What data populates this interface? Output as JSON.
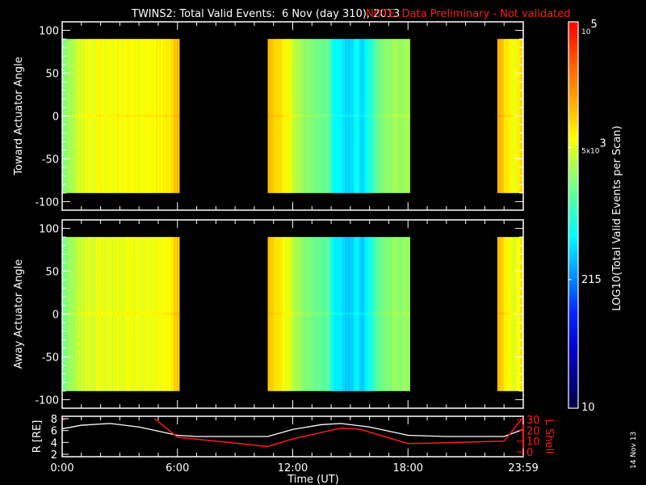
{
  "chart_data": {
    "type": "heatmap",
    "title": "TWINS2: Total Valid Events:  6 Nov (day 310), 2013",
    "note": "NOTE: Data Preliminary - Not validated",
    "xlabel": "Time (UT)",
    "xlim_hours": [
      0,
      24
    ],
    "xticks": [
      {
        "h": 0,
        "label": "0:00"
      },
      {
        "h": 6,
        "label": "6:00"
      },
      {
        "h": 12,
        "label": "12:00"
      },
      {
        "h": 18,
        "label": "18:00"
      },
      {
        "h": 24,
        "label": "23:59"
      }
    ],
    "panels": [
      {
        "ylabel": "Toward Actuator Angle",
        "ylim": [
          -110,
          110
        ],
        "yticks": [
          "100",
          "50",
          "0",
          "-50",
          "-100"
        ],
        "yvals": [
          100,
          50,
          0,
          -50,
          -100
        ],
        "offset": 0
      },
      {
        "ylabel": "Away Actuator Angle",
        "ylim": [
          -110,
          110
        ],
        "yticks": [
          "100",
          "50",
          "0",
          "-50",
          "-100"
        ],
        "yvals": [
          100,
          50,
          0,
          -50,
          -100
        ],
        "offset": -0.05
      }
    ],
    "angle_range": [
      -90,
      90
    ],
    "blocks_log10_counts": [
      {
        "start": 0.0,
        "end": 6.1,
        "values": [
          3.35,
          3.45,
          3.55,
          3.65,
          3.7,
          3.75,
          3.72,
          3.78,
          3.8,
          3.75,
          3.78,
          3.8,
          3.76,
          3.8,
          3.82,
          3.78,
          3.8,
          3.78,
          3.82,
          3.8,
          3.85,
          3.83,
          3.9,
          4.05,
          4.1
        ]
      },
      {
        "start": 10.7,
        "end": 18.1,
        "values": [
          4.1,
          4.0,
          3.95,
          3.85,
          3.8,
          3.65,
          3.55,
          3.45,
          3.4,
          3.35,
          3.3,
          3.25,
          3.3,
          2.9,
          2.75,
          2.8,
          2.6,
          2.7,
          2.85,
          2.65,
          2.8,
          3.0,
          3.2,
          3.35,
          3.4,
          3.45,
          3.5,
          3.45,
          3.5,
          3.5
        ]
      },
      {
        "start": 22.65,
        "end": 24.0,
        "values": [
          4.15,
          4.0,
          3.85,
          3.75,
          3.85,
          4.05
        ]
      }
    ],
    "colorbar": {
      "title": "LOG10(Total Valid Events per Scan)",
      "range_log10": [
        1,
        5
      ],
      "labels": [
        {
          "base": "10",
          "exp": "5",
          "v": 5
        },
        {
          "base": "5x10",
          "exp": "3",
          "v": 3.699
        },
        {
          "base": "215",
          "exp": "",
          "v": 2.332
        },
        {
          "base": "10",
          "exp": "",
          "v": 1
        }
      ]
    },
    "orbit": {
      "left_label": "R [RE]",
      "right_label": "L Shell",
      "r_ylim": [
        2,
        8
      ],
      "r_ticks": [
        "8",
        "6",
        "4",
        "2"
      ],
      "l_ylim": [
        0,
        30
      ],
      "l_ticks": [
        "30",
        "20",
        "10",
        "0"
      ],
      "r_series": [
        [
          0,
          6.3
        ],
        [
          1,
          6.9
        ],
        [
          2.5,
          7.2
        ],
        [
          4,
          6.6
        ],
        [
          6,
          5.2
        ],
        [
          7,
          5.0
        ],
        [
          10.7,
          5.0
        ],
        [
          12,
          6.2
        ],
        [
          13.5,
          7.0
        ],
        [
          14.5,
          7.2
        ],
        [
          16,
          6.6
        ],
        [
          18,
          5.2
        ],
        [
          20,
          5.0
        ],
        [
          23,
          5.0
        ],
        [
          24,
          6.2
        ]
      ],
      "l_series": [
        [
          [
            0,
            29.5
          ],
          [
            0.2,
            31
          ]
        ],
        [
          [
            4.8,
            31
          ],
          [
            6,
            13.6
          ],
          [
            10.7,
            5
          ],
          [
            12,
            12
          ],
          [
            14.5,
            22
          ],
          [
            15.5,
            21
          ],
          [
            18,
            7.7
          ],
          [
            19,
            8
          ],
          [
            23,
            10
          ],
          [
            24,
            32
          ]
        ]
      ]
    },
    "side_date": "14 Nov 13"
  }
}
